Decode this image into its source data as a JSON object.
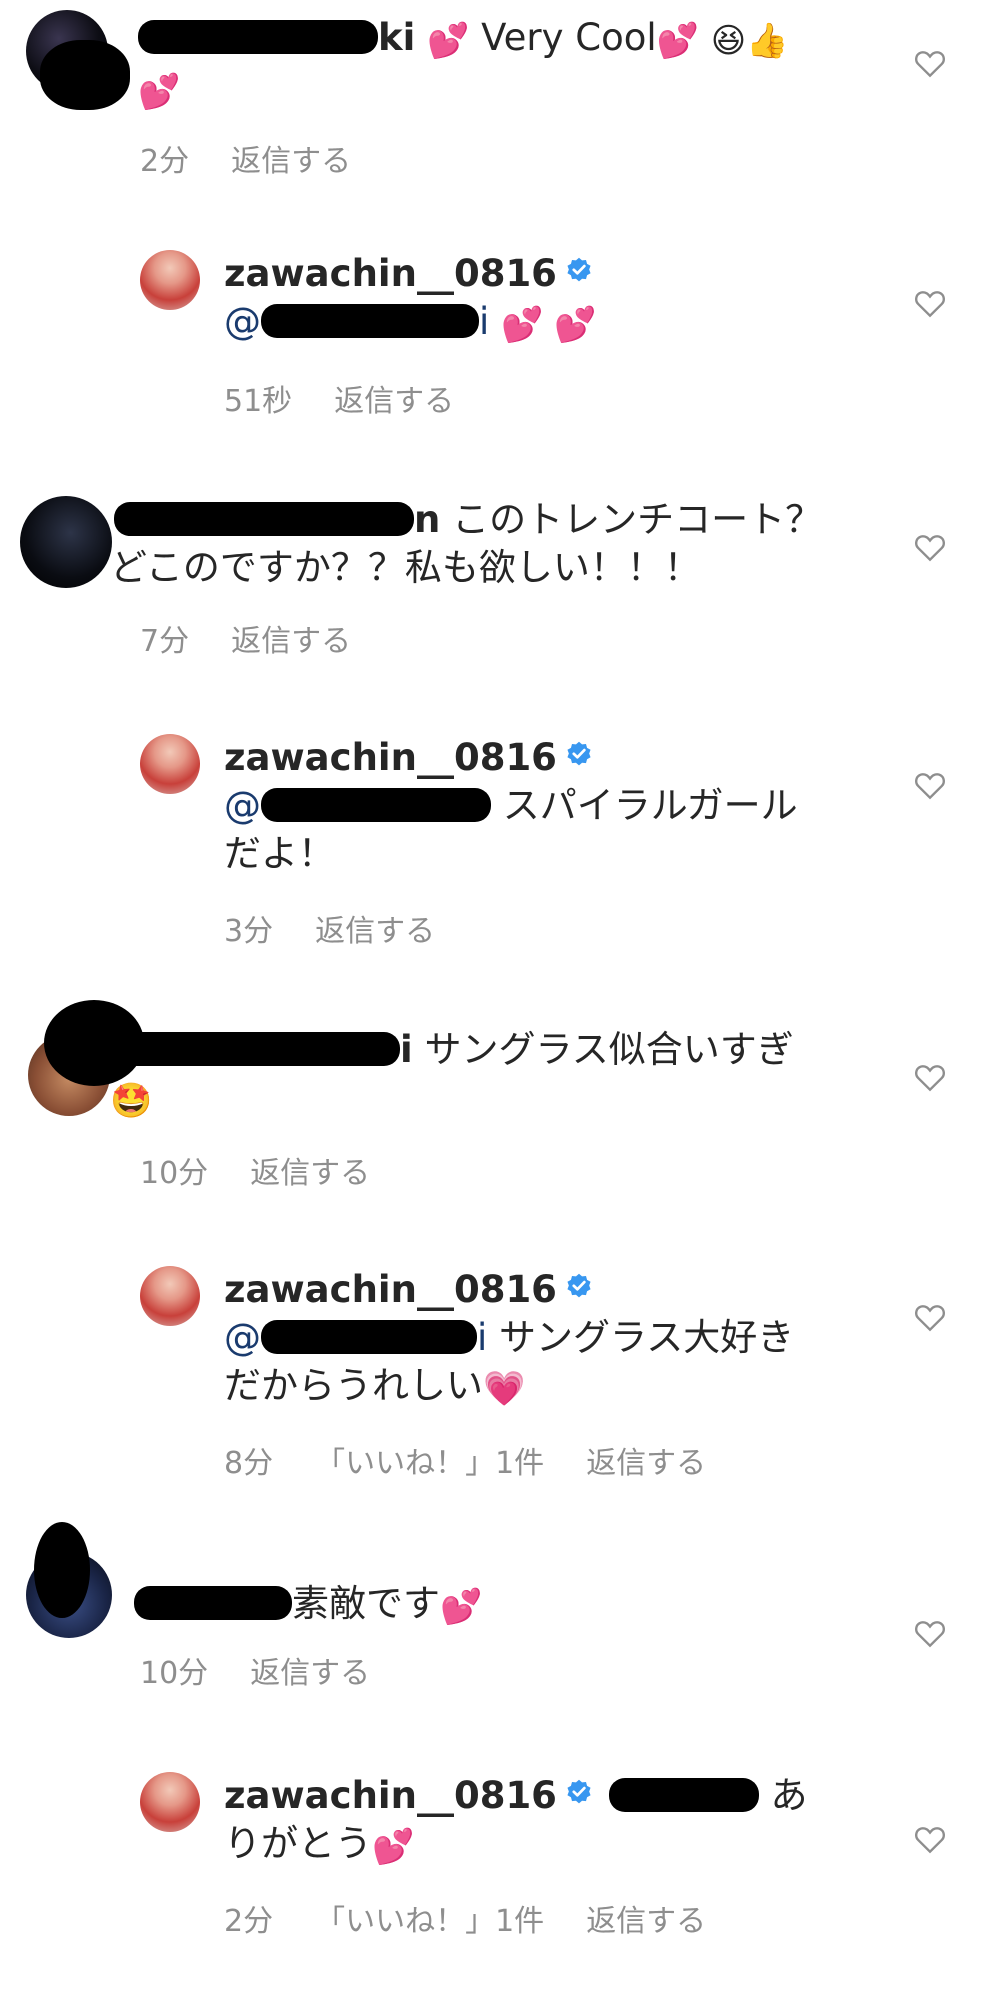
{
  "comments": [
    {
      "id": "c1",
      "name_suffix": "ki",
      "text": "Very Cool",
      "emoji_hearts": "💕",
      "emoji_face": "😆",
      "emoji_thumb": "👍",
      "time": "2分",
      "reply": "返信する"
    },
    {
      "id": "r1",
      "username": "zawachin__0816",
      "mention_prefix": "@",
      "mention_suffix": "i",
      "text": "💕 💕",
      "time": "51秒",
      "reply": "返信する"
    },
    {
      "id": "c2",
      "name_suffix": "n",
      "text_line1": "このトレンチコート？",
      "text_line2": "どこのですか？？私も欲しい！！！",
      "time": "7分",
      "reply": "返信する"
    },
    {
      "id": "r2",
      "username": "zawachin__0816",
      "mention_prefix": "@",
      "text_line1": "スパイラルガール",
      "text_line2": "だよ！",
      "time": "3分",
      "reply": "返信する"
    },
    {
      "id": "c3",
      "name_suffix": "i",
      "text_line1": "サングラス似合いすぎ",
      "emoji": "🤩",
      "time": "10分",
      "reply": "返信する"
    },
    {
      "id": "r3",
      "username": "zawachin__0816",
      "mention_prefix": "@",
      "mention_suffix": "i",
      "text_line1": "サングラス大好き",
      "text_line2": "だからうれしい",
      "emoji": "💗",
      "time": "8分",
      "likes": "「いいね！」1件",
      "reply": "返信する"
    },
    {
      "id": "c4",
      "text": "素敵です",
      "emoji": "💕",
      "time": "10分",
      "reply": "返信する"
    },
    {
      "id": "r4",
      "username": "zawachin__0816",
      "text_line1_end": "あ",
      "text_line2": "りがとう",
      "emoji": "💕",
      "time": "2分",
      "likes": "「いいね！」1件",
      "reply": "返信する"
    }
  ],
  "colors": {
    "text": "#262626",
    "meta": "#8e8e8e",
    "mention": "#1a3b6e",
    "verified": "#3897f0",
    "background": "#ffffff"
  },
  "icons": {
    "like": "heart-outline-icon",
    "verified": "verified-badge-icon"
  }
}
